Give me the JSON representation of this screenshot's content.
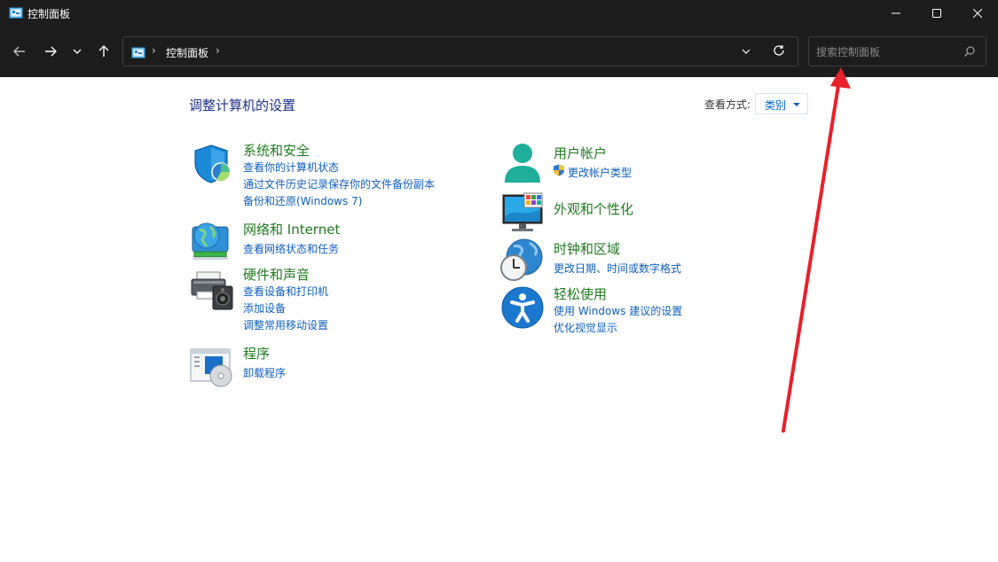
{
  "window": {
    "title": "控制面板",
    "minimize_icon": "minimize-icon",
    "maximize_icon": "maximize-icon",
    "close_icon": "close-icon"
  },
  "nav": {
    "back_icon": "arrow-left-icon",
    "forward_icon": "arrow-right-icon",
    "recent_icon": "chevron-down-icon",
    "up_icon": "arrow-up-icon",
    "breadcrumb": "控制面板",
    "refresh_icon": "refresh-icon",
    "search_placeholder": "搜索控制面板"
  },
  "content": {
    "heading": "调整计算机的设置",
    "view_by_label": "查看方式:",
    "view_by_value": "类别"
  },
  "left_categories": [
    {
      "title": "系统和安全",
      "icon": "shield-icon",
      "links": [
        "查看你的计算机状态",
        "通过文件历史记录保存你的文件备份副本",
        "备份和还原(Windows 7)"
      ]
    },
    {
      "title": "网络和 Internet",
      "icon": "network-globe-icon",
      "links": [
        "查看网络状态和任务"
      ]
    },
    {
      "title": "硬件和声音",
      "icon": "printer-speaker-icon",
      "links": [
        "查看设备和打印机",
        "添加设备",
        "调整常用移动设置"
      ]
    },
    {
      "title": "程序",
      "icon": "programs-disc-icon",
      "links": [
        "卸载程序"
      ]
    }
  ],
  "right_categories": [
    {
      "title": "用户帐户",
      "icon": "user-icon",
      "links": [
        "更改帐户类型"
      ]
    },
    {
      "title": "外观和个性化",
      "icon": "monitor-icon",
      "links": []
    },
    {
      "title": "时钟和区域",
      "icon": "clock-globe-icon",
      "links": [
        "更改日期、时间或数字格式"
      ]
    },
    {
      "title": "轻松使用",
      "icon": "accessibility-icon",
      "links": [
        "使用 Windows 建议的设置",
        "优化视觉显示"
      ]
    }
  ],
  "annotation": {
    "color": "#e8202a"
  }
}
